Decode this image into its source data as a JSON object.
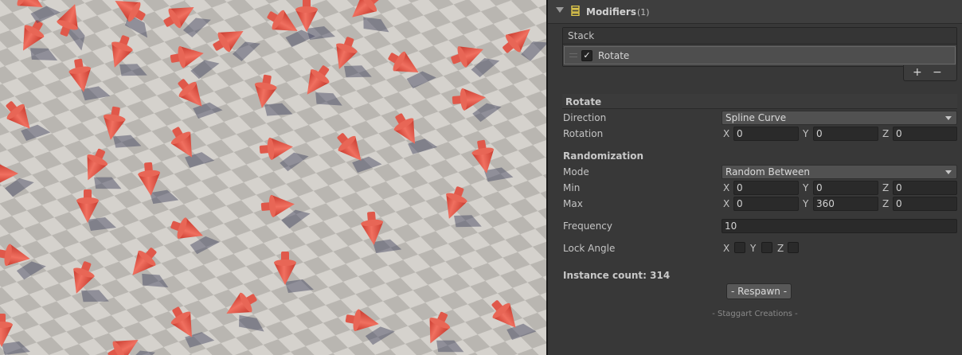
{
  "modifiers": {
    "title": "Modifiers",
    "count": "(1)",
    "stack_header": "Stack",
    "stack_items": [
      {
        "label": "Rotate",
        "enabled": true
      }
    ],
    "add_label": "+",
    "remove_label": "−"
  },
  "rotate": {
    "section_title": "Rotate",
    "direction_label": "Direction",
    "direction_value": "Spline Curve",
    "rotation_label": "Rotation",
    "rotation": {
      "x_label": "X",
      "x": "0",
      "y_label": "Y",
      "y": "0",
      "z_label": "Z",
      "z": "0"
    }
  },
  "randomization": {
    "title": "Randomization",
    "mode_label": "Mode",
    "mode_value": "Random Between",
    "min_label": "Min",
    "min": {
      "x_label": "X",
      "x": "0",
      "y_label": "Y",
      "y": "0",
      "z_label": "Z",
      "z": "0"
    },
    "max_label": "Max",
    "max": {
      "x_label": "X",
      "x": "0",
      "y_label": "Y",
      "y": "360",
      "z_label": "Z",
      "z": "0"
    },
    "frequency_label": "Frequency",
    "frequency_value": "10",
    "lock_angle_label": "Lock Angle",
    "lock": {
      "x_label": "X",
      "x": false,
      "y_label": "Y",
      "y": false,
      "z_label": "Z",
      "z": false
    }
  },
  "footer": {
    "instance_count": "Instance count: 314",
    "respawn_label": "- Respawn -",
    "credit": "- Staggart Creations -"
  },
  "colors": {
    "panel_bg": "#383838",
    "field_bg": "#2a2a2a",
    "arrow_red": "#e35a4c",
    "ground_light": "#d5d2cd",
    "ground_dark": "#b9b6b1"
  }
}
